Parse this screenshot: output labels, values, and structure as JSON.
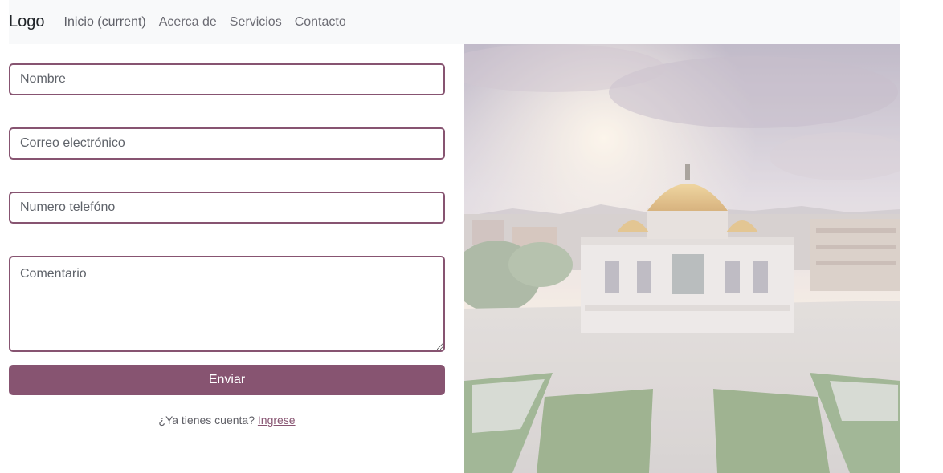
{
  "navbar": {
    "brand": "Logo",
    "links": [
      "Inicio (current)",
      "Acerca de",
      "Servicios",
      "Contacto"
    ]
  },
  "form": {
    "name_placeholder": "Nombre",
    "email_placeholder": "Correo electrónico",
    "phone_placeholder": "Numero telefóno",
    "comment_placeholder": "Comentario",
    "submit_label": "Enviar",
    "account_prompt": "¿Ya tienes cuenta?",
    "login_link": "Ingrese"
  },
  "colors": {
    "accent": "#875471",
    "navbar_bg": "#f8f9fa"
  },
  "image": {
    "subject": "palacio-de-bellas-artes-photo"
  }
}
